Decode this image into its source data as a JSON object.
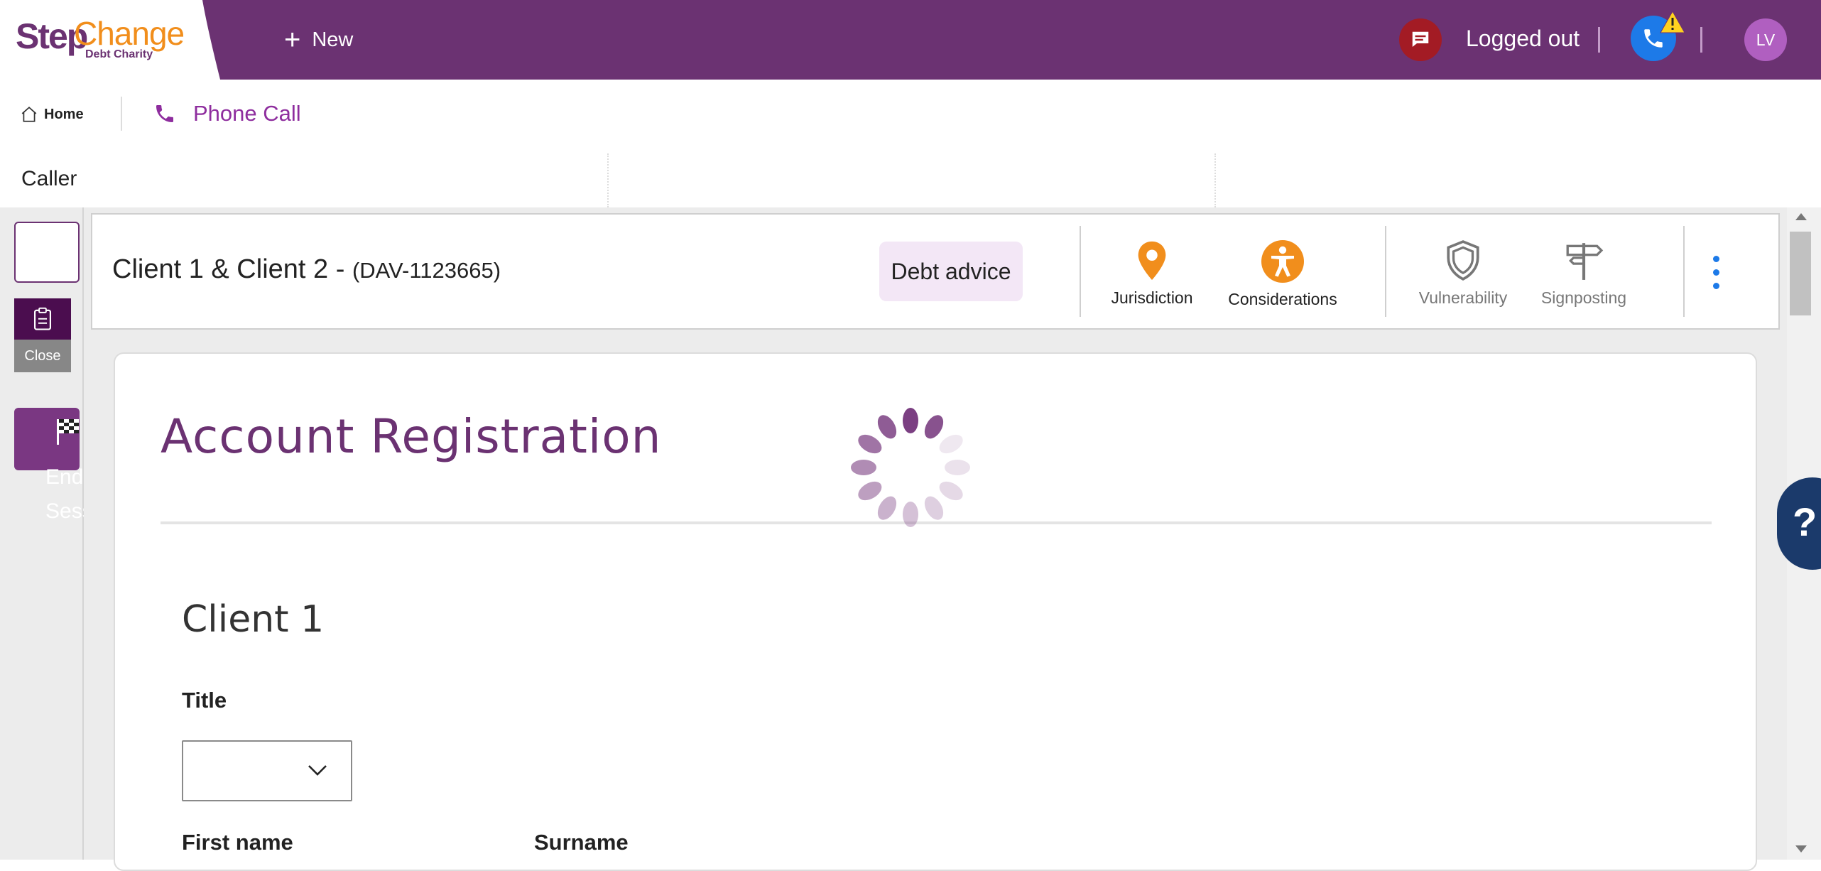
{
  "topbar": {
    "logo": {
      "step": "Step",
      "change": "Change",
      "sub": "Debt Charity"
    },
    "new_label": "New",
    "status": "Logged out",
    "avatar_initials": "LV",
    "colors": {
      "brand": "#6b3272",
      "chat": "#a31b24",
      "phone": "#1d7ae8",
      "avatar": "#b05fc0"
    }
  },
  "tabs": {
    "home": "Home",
    "phone_call": "Phone Call"
  },
  "caller": {
    "label": "Caller"
  },
  "left_rail": {
    "close_label": "Close",
    "end_session_label": "End Session"
  },
  "case_header": {
    "clients": "Client 1  & Client 2  -",
    "reference": "(DAV-1123665)",
    "category": "Debt advice",
    "icons": [
      {
        "name": "jurisdiction",
        "label": "Jurisdiction",
        "icon": "map-pin-icon",
        "color": "#f18e1c"
      },
      {
        "name": "considerations",
        "label": "Considerations",
        "icon": "accessibility-icon",
        "color": "#f18e1c"
      },
      {
        "name": "vulnerability",
        "label": "Vulnerability",
        "icon": "shield-icon",
        "color": "#777777"
      },
      {
        "name": "signposting",
        "label": "Signposting",
        "icon": "signpost-icon",
        "color": "#777777"
      }
    ]
  },
  "registration": {
    "title": "Account Registration",
    "client_heading": "Client 1",
    "fields": {
      "title_label": "Title",
      "title_value": "",
      "first_name_label": "First name",
      "surname_label": "Surname"
    }
  },
  "help": {
    "label": "?"
  }
}
